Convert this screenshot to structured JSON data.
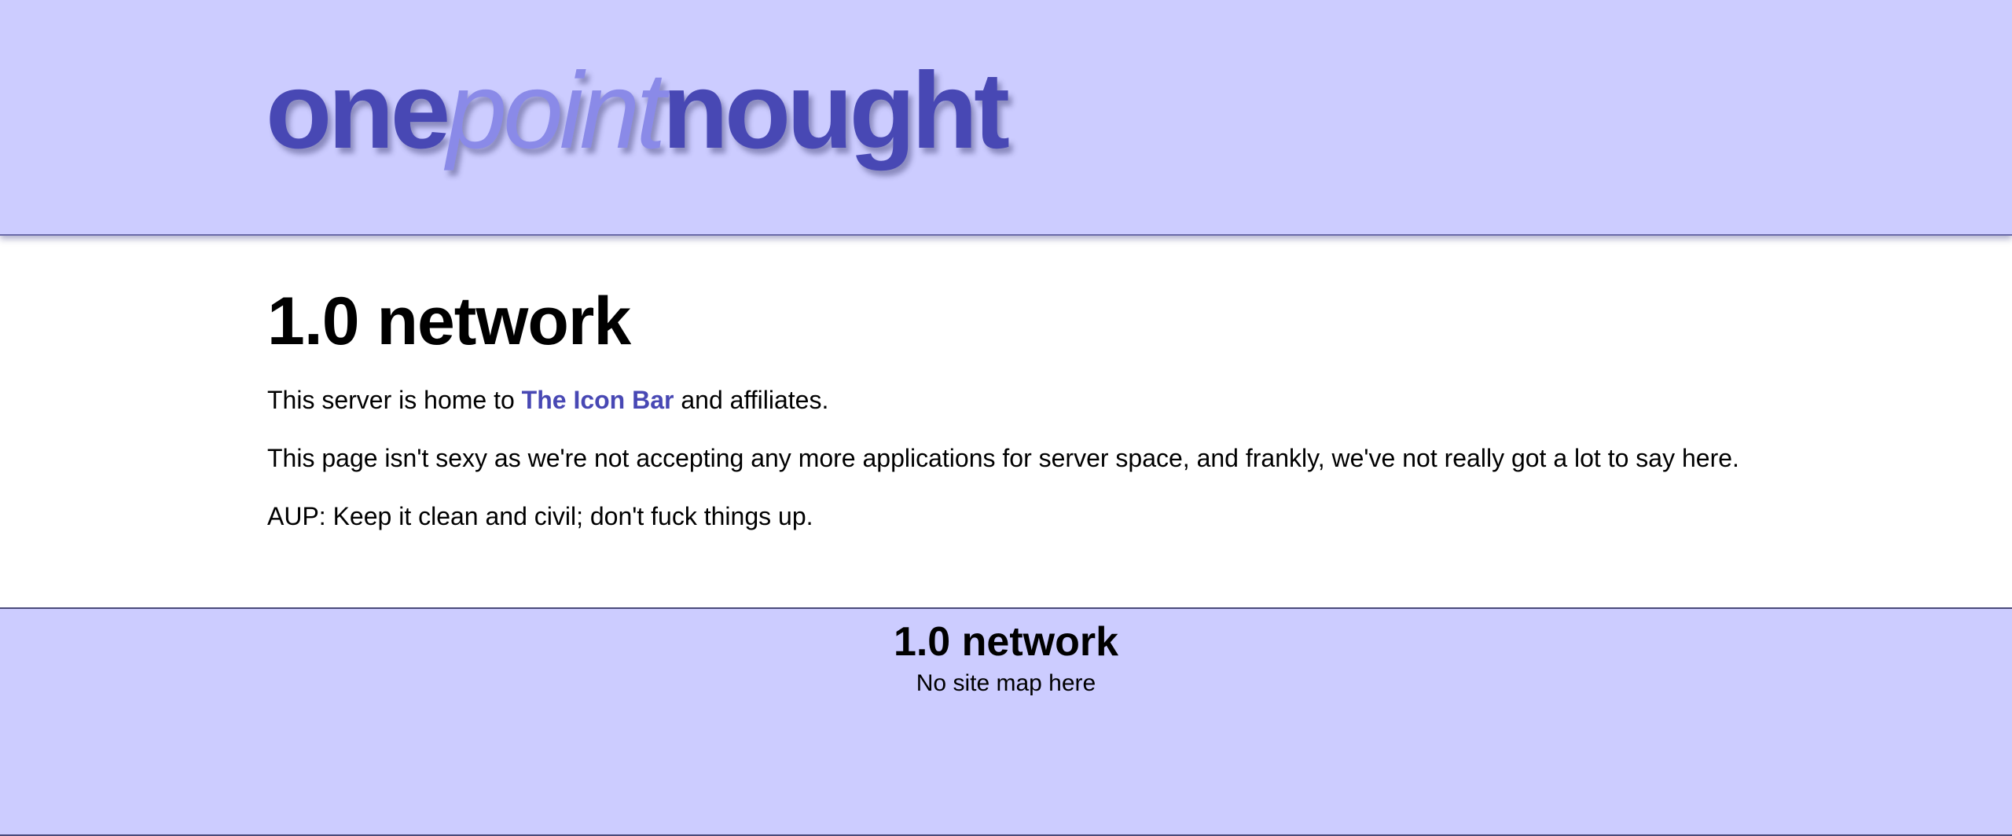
{
  "header": {
    "logo": {
      "part_one": "one",
      "part_point": "point",
      "part_nought": "nought"
    }
  },
  "main": {
    "title": "1.0 network",
    "paragraph1": {
      "before": "This server is home to ",
      "link": "The Icon Bar",
      "after": " and affiliates."
    },
    "paragraph2": "This page isn't sexy as we're not accepting any more applications for server space, and frankly, we've not really got a lot to say here.",
    "paragraph3": "AUP: Keep it clean and civil; don't fuck things up."
  },
  "footer": {
    "title": "1.0 network",
    "subtitle": "No site map here"
  },
  "colors": {
    "header_bg": "#ccccff",
    "logo_dark": "#4848b4",
    "logo_light": "#8a8ae8",
    "link": "#4848b4"
  }
}
